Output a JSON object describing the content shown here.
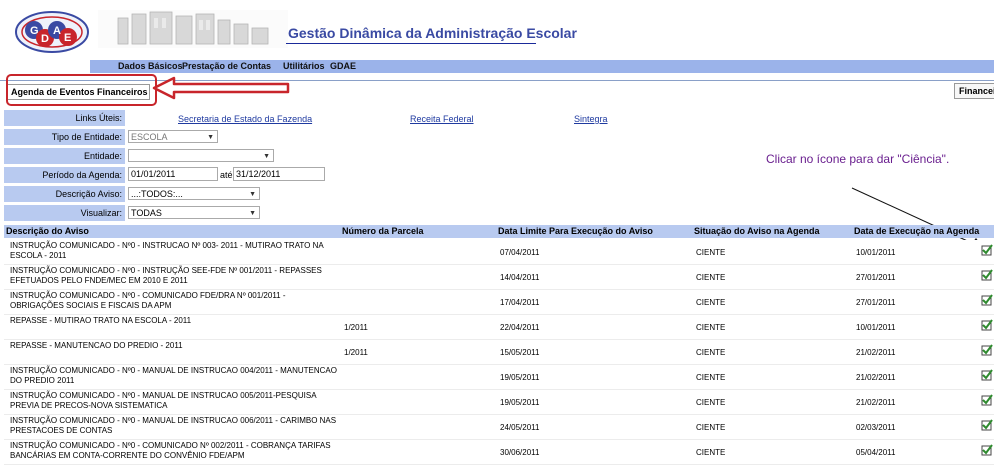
{
  "header": {
    "logo_text": "GDAE",
    "app_title": "Gestão Dinâmica da Administração Escolar"
  },
  "menu": {
    "items": [
      "Dados Básicos",
      "Prestação de Contas",
      "Utilitários",
      "GDAE"
    ]
  },
  "tabs": {
    "active": "Agenda de Eventos Financeiros",
    "right": "Financei"
  },
  "form": {
    "links_label": "Links Úteis:",
    "links": [
      "Secretaria de Estado da Fazenda",
      "Receita Federal",
      "Sintegra"
    ],
    "tipo_label": "Tipo de Entidade:",
    "tipo_value": "ESCOLA",
    "entidade_label": "Entidade:",
    "entidade_value": "",
    "periodo_label": "Período da Agenda:",
    "periodo_from": "01/01/2011",
    "periodo_ate": "até",
    "periodo_to": "31/12/2011",
    "descricao_label": "Descrição Aviso:",
    "descricao_value": "...:TODOS:...",
    "visualizar_label": "Visualizar:",
    "visualizar_value": "TODAS"
  },
  "hint_text": "Clicar no ícone para dar \"Ciência\".",
  "table": {
    "columns": [
      "Descrição do Aviso",
      "Número da Parcela",
      "Data Limite Para Execução do Aviso",
      "Situação do Aviso na Agenda",
      "Data de Execução na Agenda"
    ],
    "rows": [
      {
        "desc": "INSTRUÇÃO COMUNICADO - Nº0 - INSTRUCAO Nº 003- 2011 - MUTIRAO TRATO NA ESCOLA - 2011",
        "parcela": "",
        "limite": "07/04/2011",
        "situacao": "CIENTE",
        "execucao": "10/01/2011"
      },
      {
        "desc": "INSTRUÇÃO COMUNICADO - Nº0 - INSTRUÇÃO SEE-FDE Nº 001/2011 - REPASSES EFETUADOS PELO FNDE/MEC EM 2010 E 2011",
        "parcela": "",
        "limite": "14/04/2011",
        "situacao": "CIENTE",
        "execucao": "27/01/2011"
      },
      {
        "desc": "INSTRUÇÃO COMUNICADO - Nº0 - COMUNICADO FDE/DRA Nº 001/2011 - OBRIGAÇÕES SOCIAIS E FISCAIS DA APM",
        "parcela": "",
        "limite": "17/04/2011",
        "situacao": "CIENTE",
        "execucao": "27/01/2011"
      },
      {
        "desc": "REPASSE - MUTIRAO TRATO NA ESCOLA - 2011",
        "parcela": "1/2011",
        "limite": "22/04/2011",
        "situacao": "CIENTE",
        "execucao": "10/01/2011"
      },
      {
        "desc": "REPASSE - MANUTENCAO DO PREDIO - 2011",
        "parcela": "1/2011",
        "limite": "15/05/2011",
        "situacao": "CIENTE",
        "execucao": "21/02/2011"
      },
      {
        "desc": "INSTRUÇÃO COMUNICADO - Nº0 - MANUAL DE INSTRUCAO 004/2011 - MANUTENCAO DO PREDIO 2011",
        "parcela": "",
        "limite": "19/05/2011",
        "situacao": "CIENTE",
        "execucao": "21/02/2011"
      },
      {
        "desc": "INSTRUÇÃO COMUNICADO - Nº0 - MANUAL DE INSTRUCAO 005/2011-PESQUISA PREVIA DE PRECOS-NOVA SISTEMATICA",
        "parcela": "",
        "limite": "19/05/2011",
        "situacao": "CIENTE",
        "execucao": "21/02/2011"
      },
      {
        "desc": "INSTRUÇÃO COMUNICADO - Nº0 - MANUAL DE INSTRUCAO 006/2011 - CARIMBO NAS PRESTACOES DE CONTAS",
        "parcela": "",
        "limite": "24/05/2011",
        "situacao": "CIENTE",
        "execucao": "02/03/2011"
      },
      {
        "desc": "INSTRUÇÃO COMUNICADO - Nº0 - COMUNICADO Nº 002/2011 - COBRANÇA TARIFAS BANCÁRIAS EM CONTA-CORRENTE DO CONVÊNIO FDE/APM",
        "parcela": "",
        "limite": "30/06/2011",
        "situacao": "CIENTE",
        "execucao": "05/04/2011"
      }
    ]
  },
  "colors": {
    "label_bg": "#b8caf0",
    "menu_bg": "#9bb3ea",
    "title_blue": "#3a4aa3",
    "highlight_red": "#c8252b",
    "hint_purple": "#6a1f8f",
    "check_green": "#2e8b2e"
  }
}
